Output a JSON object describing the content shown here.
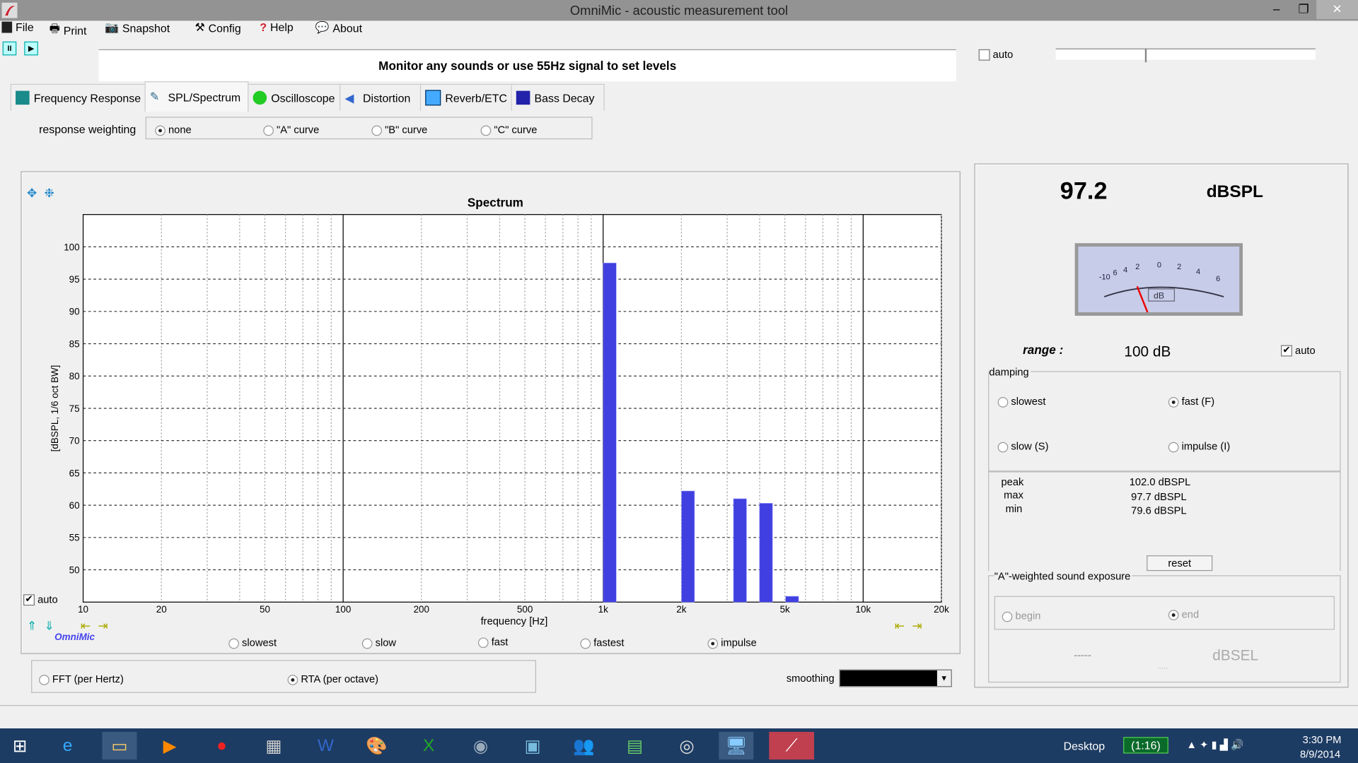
{
  "window": {
    "title": "OmniMic - acoustic measurement tool",
    "minimize": "–",
    "maximize": "❐",
    "close": "✕"
  },
  "menu": [
    {
      "label": "File",
      "icon": "floppy-icon"
    },
    {
      "label": "Print",
      "icon": "printer-icon"
    },
    {
      "label": "Snapshot",
      "icon": "camera-icon"
    },
    {
      "label": "Config",
      "icon": "tools-icon"
    },
    {
      "label": "Help",
      "icon": "question-icon"
    },
    {
      "label": "About",
      "icon": "speech-bubble-icon"
    }
  ],
  "toolbar": {
    "pause": "II",
    "play": "▶"
  },
  "message": "Monitor any sounds or use 55Hz signal to set levels",
  "top_auto": {
    "label": "auto",
    "checked": false
  },
  "level_slider": {
    "value": 0.35
  },
  "tabs": [
    {
      "label": "Frequency Response"
    },
    {
      "label": "SPL/Spectrum",
      "active": true
    },
    {
      "label": "Oscilloscope"
    },
    {
      "label": "Distortion"
    },
    {
      "label": "Reverb/ETC"
    },
    {
      "label": "Bass Decay"
    }
  ],
  "weighting": {
    "label": "response weighting",
    "options": [
      "none",
      "\"A\" curve",
      "\"B\" curve",
      "\"C\" curve"
    ],
    "selected": "none"
  },
  "chart_controls": {
    "auto_label": "auto",
    "auto_checked": true,
    "brand": "OmniMic",
    "response": {
      "options": [
        "slowest",
        "slow",
        "fast",
        "fastest",
        "impulse"
      ],
      "selected": "impulse"
    },
    "mode": {
      "options": [
        "FFT (per Hertz)",
        "RTA (per octave)"
      ],
      "selected": "RTA (per octave)"
    },
    "smoothing_label": "smoothing",
    "smoothing_value": ""
  },
  "chart_data": {
    "type": "bar",
    "title": "Spectrum",
    "xlabel": "frequency [Hz]",
    "ylabel": "[dBSPL, 1/6 oct BW]",
    "xscale": "log",
    "xlim": [
      10,
      20000
    ],
    "ylim": [
      45,
      105
    ],
    "grid": true,
    "xticks": [
      {
        "v": 10,
        "l": "10"
      },
      {
        "v": 20,
        "l": "20"
      },
      {
        "v": 50,
        "l": "50"
      },
      {
        "v": 100,
        "l": "100"
      },
      {
        "v": 200,
        "l": "200"
      },
      {
        "v": 500,
        "l": "500"
      },
      {
        "v": 1000,
        "l": "1k"
      },
      {
        "v": 2000,
        "l": "2k"
      },
      {
        "v": 5000,
        "l": "5k"
      },
      {
        "v": 10000,
        "l": "10k"
      },
      {
        "v": 20000,
        "l": "20k"
      }
    ],
    "yticks": [
      50,
      55,
      60,
      65,
      70,
      75,
      80,
      85,
      90,
      95,
      100
    ],
    "band_width_octaves": 0.1667,
    "bars": [
      {
        "x": 1060,
        "y": 97.5
      },
      {
        "x": 2120,
        "y": 62.2
      },
      {
        "x": 3360,
        "y": 61.0
      },
      {
        "x": 4230,
        "y": 60.3
      },
      {
        "x": 5330,
        "y": 45.9
      }
    ],
    "bar_color": "#4040e0"
  },
  "readout": {
    "value": "97.2",
    "unit": "dBSPL",
    "meter_labels": [
      "-10",
      "6",
      "4",
      "2",
      "0",
      "2",
      "4",
      "6"
    ],
    "meter_unit": "dB",
    "range_label": "range :",
    "range_value": "100 dB",
    "range_auto_label": "auto",
    "range_auto": true
  },
  "damping": {
    "title": "damping",
    "options": [
      "slowest",
      "fast (F)",
      "slow (S)",
      "impulse (I)"
    ],
    "selected": "fast (F)"
  },
  "stats": [
    {
      "label": "peak",
      "value": "102.0 dBSPL"
    },
    {
      "label": "max",
      "value": "97.7 dBSPL"
    },
    {
      "label": "min",
      "value": "79.6 dBSPL"
    }
  ],
  "reset_label": "reset",
  "exposure": {
    "title": "\"A\"-weighted sound exposure",
    "options": [
      "begin",
      "end"
    ],
    "selected": "end",
    "value": "-----",
    "unit": "dBSEL",
    "sub": "....."
  },
  "taskbar": {
    "apps": [
      "start",
      "internet-explorer",
      "file-explorer",
      "media-player",
      "app-red",
      "calculator",
      "word",
      "paint",
      "excel",
      "disk",
      "control-panel",
      "people",
      "prompt",
      "media-center",
      "remote-desktop",
      "omnimic"
    ],
    "desktop_label": "Desktop",
    "battery": "(1:16)",
    "time": "3:30 PM",
    "date": "8/9/2014"
  }
}
